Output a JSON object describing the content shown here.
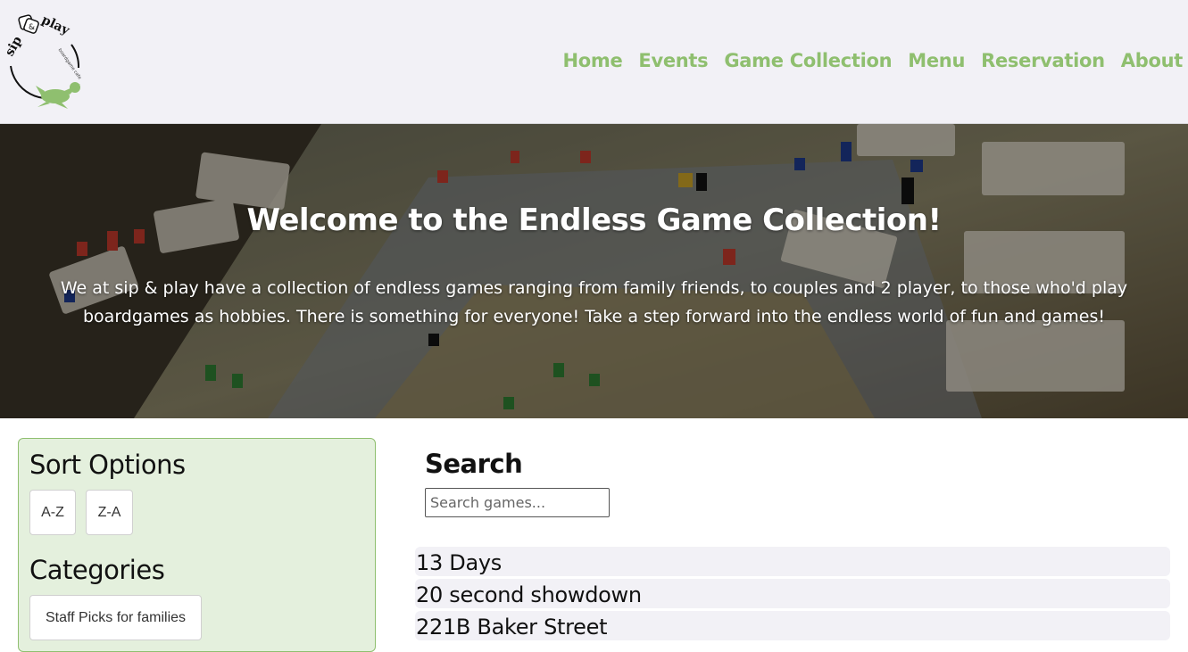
{
  "header": {
    "logo": {
      "brand_text": "sip & play",
      "tagline": "boardgame cafe"
    },
    "nav": [
      {
        "label": "Home"
      },
      {
        "label": "Events"
      },
      {
        "label": "Game Collection"
      },
      {
        "label": "Menu"
      },
      {
        "label": "Reservation"
      },
      {
        "label": "About"
      }
    ],
    "nav_color": "#8fbf6f"
  },
  "hero": {
    "title": "Welcome to the Endless Game Collection!",
    "text": "We at sip & play have a collection of endless games ranging from family friends, to couples and 2 player, to those who'd play boardgames as hobbies. There is something for everyone! Take a step forward into the endless world of fun and games!"
  },
  "sidebar": {
    "sort_title": "Sort Options",
    "sort_buttons": [
      {
        "label": "A-Z"
      },
      {
        "label": "Z-A"
      }
    ],
    "categories_title": "Categories",
    "category_buttons": [
      {
        "label": "Staff Picks for families"
      }
    ],
    "background": "#e4f0dd",
    "border": "#8fbf6f"
  },
  "search": {
    "title": "Search",
    "placeholder": "Search games..."
  },
  "games": [
    {
      "name": "13 Days"
    },
    {
      "name": "20 second showdown"
    },
    {
      "name": "221B Baker Street"
    }
  ]
}
